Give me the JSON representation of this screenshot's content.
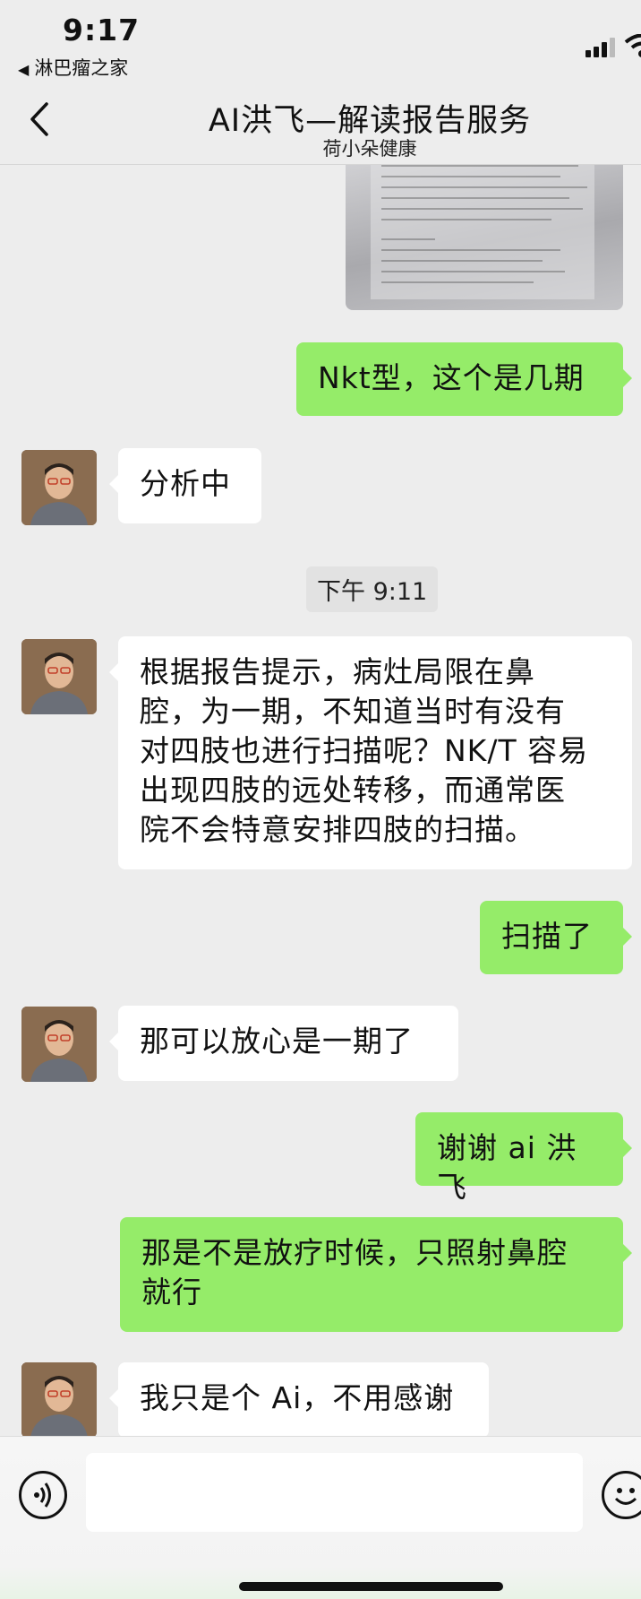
{
  "status_bar": {
    "time": "9:17",
    "back_app": "淋巴瘤之家"
  },
  "header": {
    "title": "AI洪飞—解读报告服务",
    "subtitle": "荷小朵健康"
  },
  "messages": [
    {
      "side": "out",
      "kind": "image",
      "content": "report-photo"
    },
    {
      "side": "out",
      "kind": "text",
      "text": "Nkt型，这个是几期"
    },
    {
      "side": "in",
      "kind": "text",
      "text": "分析中"
    },
    {
      "kind": "timestamp",
      "text": "下午 9:11"
    },
    {
      "side": "in",
      "kind": "text",
      "text": "根据报告提示，病灶局限在鼻\n腔，为一期，不知道当时有没有\n对四肢也进行扫描呢？NK/T 容易\n出现四肢的远处转移，而通常医\n院不会特意安排四肢的扫描。"
    },
    {
      "side": "out",
      "kind": "text",
      "text": "扫描了"
    },
    {
      "side": "in",
      "kind": "text",
      "text": "那可以放心是一期了"
    },
    {
      "side": "out",
      "kind": "text",
      "text": "谢谢 ai 洪飞"
    },
    {
      "side": "out",
      "kind": "text",
      "text": "那是不是放疗时候，只照射鼻腔\n就行"
    },
    {
      "side": "in",
      "kind": "text",
      "text": "我只是个 Ai，不用感谢"
    }
  ],
  "input": {
    "placeholder": ""
  },
  "icons": {
    "back": "chevron-left-icon",
    "voice": "voice-icon",
    "emoji": "emoji-icon",
    "signal": "signal-icon",
    "wifi": "wifi-icon"
  },
  "colors": {
    "background": "#ededed",
    "outgoing_bubble": "#95ec69",
    "incoming_bubble": "#ffffff"
  }
}
